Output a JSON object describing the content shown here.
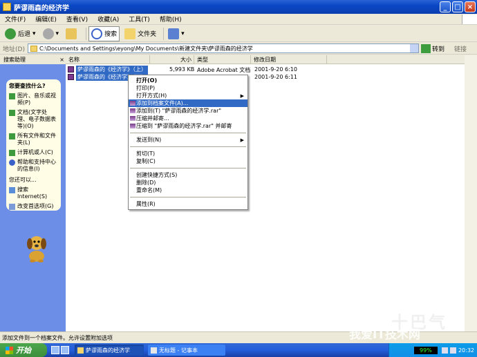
{
  "window": {
    "title": "萨谬雨森的经济学"
  },
  "menu": [
    "文件(F)",
    "编辑(E)",
    "查看(V)",
    "收藏(A)",
    "工具(T)",
    "帮助(H)"
  ],
  "toolbar": {
    "back": "后退",
    "search": "搜索",
    "folders": "文件夹"
  },
  "address": {
    "label": "地址(D)",
    "path": "C:\\Documents and Settings\\eyong\\My Documents\\新建文件夹\\萨谬雨森的经济学",
    "go": "转到",
    "links": "链接"
  },
  "search_assistant": {
    "title": "搜索助理"
  },
  "left_panel": {
    "question": "您要查找什么?",
    "items": [
      "图片、音乐或视频(P)",
      "文档(文字处理、电子数据表等)(O)",
      "所有文件和文件夹(L)",
      "计算机或人(C)",
      "帮助和支持中心的信息(I)"
    ],
    "also": "您还可以...",
    "items2": [
      "搜索Internet(S)",
      "改变首选项(G)"
    ]
  },
  "columns": [
    "名称",
    "大小",
    "类型",
    "修改日期"
  ],
  "files": [
    {
      "name": "萨谬雨森的《经济学》（上）",
      "size": "5,993 KB",
      "type": "Adobe Acrobat 文档",
      "date": "2001-9-20 6:10"
    },
    {
      "name": "萨谬雨森的《经济学》（下）",
      "size": "",
      "type": "",
      "date": "2001-9-20 6:11"
    }
  ],
  "context_menu": {
    "open": "打开(O)",
    "print": "打印(P)",
    "open_with": "打开方式(H)",
    "add_archive": "添加到档案文件(A)...",
    "add_named": "添加到(T) \"萨谬雨森的经济学.rar\"",
    "compress_mail": "压缩并邮寄...",
    "compress_named_mail": "压缩到 \"萨谬雨森的经济学.rar\" 并邮寄",
    "send_to": "发送到(N)",
    "cut": "剪切(T)",
    "copy": "复制(C)",
    "create_shortcut": "创建快捷方式(S)",
    "delete": "删除(D)",
    "rename": "重命名(M)",
    "properties": "属性(R)"
  },
  "status": {
    "text": "添加文件到一个档案文件。允许设置附加选项"
  },
  "taskbar": {
    "start": "开始",
    "tasks": [
      "萨谬雨森的经济学",
      "无标题 - 记事本"
    ],
    "meter": "99%",
    "clock": "20:32"
  },
  "watermark": {
    "line1": "我爱IT技术网",
    "line2": "十巴气"
  }
}
